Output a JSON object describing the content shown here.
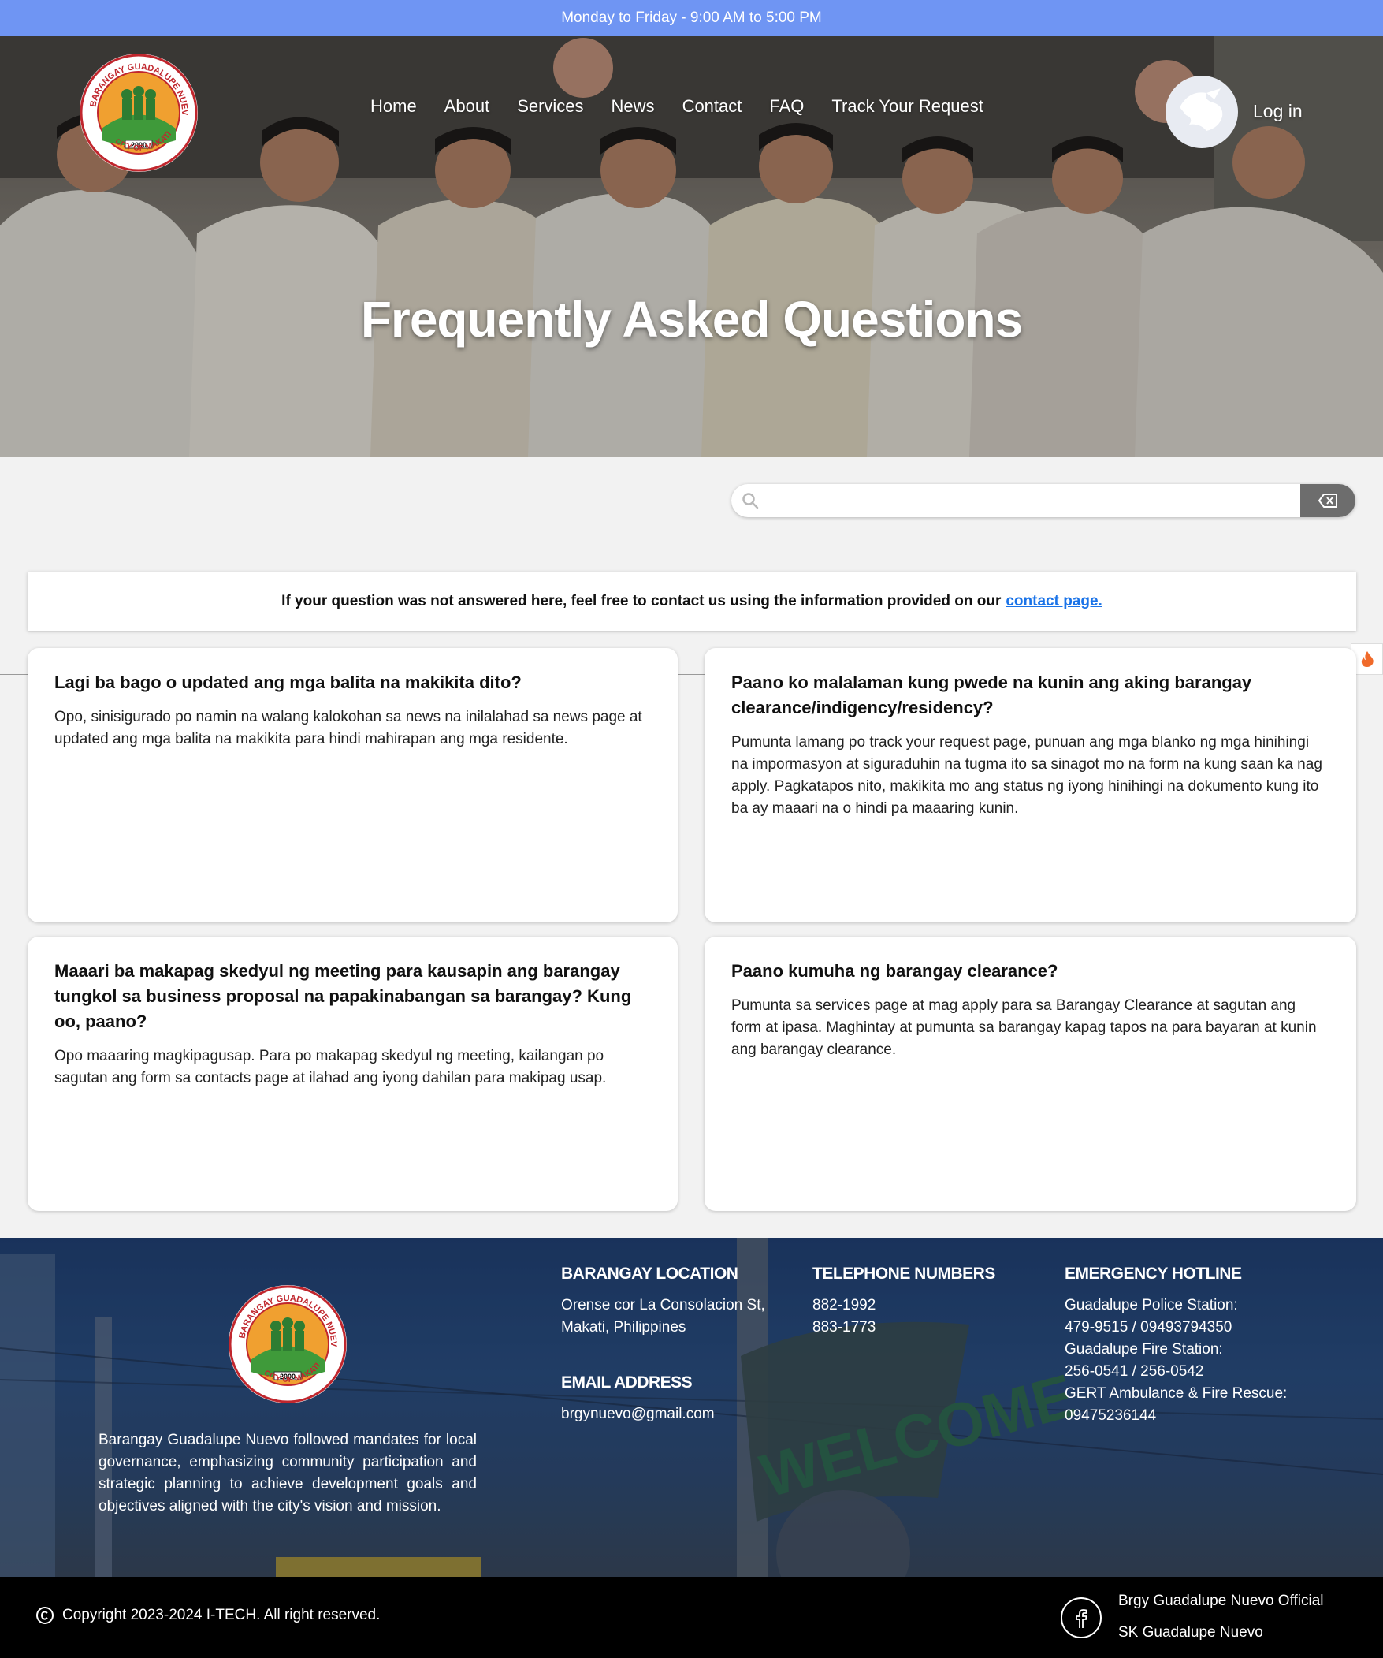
{
  "topbar": {
    "hours": "Monday to Friday - 9:00 AM to 5:00 PM"
  },
  "nav": {
    "items": [
      "Home",
      "About",
      "Services",
      "News",
      "Contact",
      "FAQ",
      "Track Your Request"
    ],
    "login": "Log in"
  },
  "hero": {
    "title": "Frequently Asked Questions"
  },
  "search": {
    "placeholder": "",
    "value": ""
  },
  "notice": {
    "text": "If your question was not answered here, feel free to contact us using the information provided on our",
    "link": "contact page."
  },
  "faqs": [
    {
      "question": "Lagi ba bago o updated ang mga balita na makikita dito?",
      "answer": "Opo, sinisigurado po namin na walang kalokohan sa news na inilalahad sa news page at updated ang mga balita na makikita para hindi mahirapan ang mga residente."
    },
    {
      "question": "Paano ko malalaman kung pwede na kunin ang aking barangay clearance/indigency/residency?",
      "answer": "Pumunta lamang po track your request page, punuan ang mga blanko ng mga hinihingi na impormasyon at siguraduhin na tugma ito sa sinagot mo na form na kung saan ka nag apply. Pagkatapos nito, makikita mo ang status ng iyong hinihingi na dokumento kung ito ba ay maaari na o hindi pa maaaring kunin."
    },
    {
      "question": "Maaari ba makapag skedyul ng meeting para kausapin ang barangay tungkol sa business proposal na papakinabangan sa barangay? Kung oo, paano?",
      "answer": "Opo maaaring magkipagusap. Para po makapag skedyul ng meeting, kailangan po sagutan ang form sa contacts page at ilahad ang iyong dahilan para makipag usap."
    },
    {
      "question": "Paano kumuha ng barangay clearance?",
      "answer": "Pumunta sa services page at mag apply para sa Barangay Clearance at sagutan ang form at ipasa. Maghintay at pumunta sa barangay kapag tapos na para bayaran at kunin ang barangay clearance."
    }
  ],
  "logo": {
    "top_text": "BARANGAY GUADALUPE NUEVO",
    "bottom_text": "CITY OF MAKATI",
    "year": "2000"
  },
  "footer": {
    "description": "Barangay Guadalupe Nuevo followed mandates for local governance, emphasizing community participation and strategic planning to achieve development goals and objectives aligned with the city's vision and mission.",
    "location_title": "BARANGAY LOCATION",
    "location_lines": [
      "Orense cor La Consolacion St,",
      "Makati, Philippines"
    ],
    "email_title": "EMAIL ADDRESS",
    "email": "brgynuevo@gmail.com",
    "phone_title": "TELEPHONE NUMBERS",
    "phones": [
      "882-1992",
      "883-1773"
    ],
    "emergency_title": "EMERGENCY HOTLINE",
    "emergency_lines": [
      "Guadalupe Police Station:",
      "479-9515 / 09493794350",
      "Guadalupe Fire Station:",
      "256-0541 / 256-0542",
      "GERT Ambulance & Fire Rescue:",
      "09475236144"
    ],
    "background_sign": "WELCOME"
  },
  "bottom": {
    "copyright": "Copyright 2023-2024 I-TECH. All right reserved.",
    "social": [
      "Brgy Guadalupe Nuevo Official",
      "SK Guadalupe Nuevo"
    ]
  },
  "icons": {
    "search": "search-icon",
    "clear": "backspace-icon",
    "facebook": "facebook-icon",
    "copyright": "copyright-icon",
    "fire": "fire-icon",
    "user": "user-avatar-icon"
  },
  "colors": {
    "topbar": "#6f95f3",
    "link": "#1a73e8",
    "footer": "#1e3a63",
    "bottom": "#000000"
  }
}
